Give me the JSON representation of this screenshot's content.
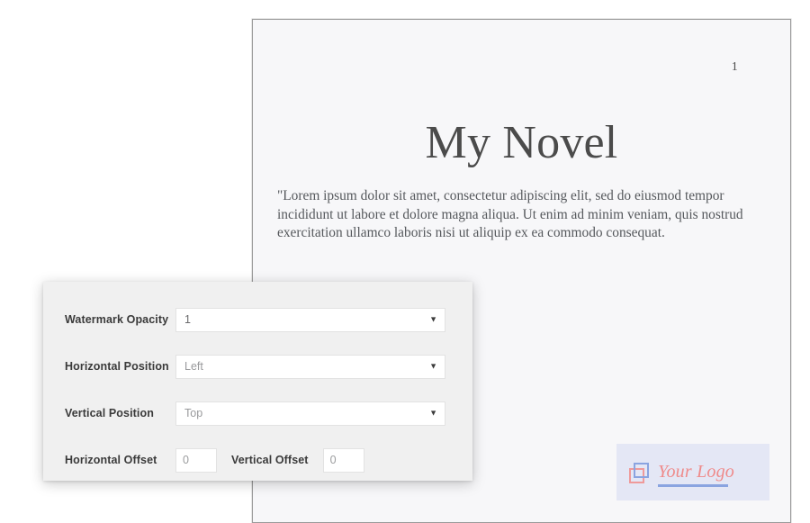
{
  "document": {
    "page_number": "1",
    "title": "My Novel",
    "body": "\"Lorem ipsum dolor sit amet, consectetur adipiscing elit, sed do eiusmod tempor incididunt ut labore et dolore magna aliqua. Ut enim ad minim veniam, quis nostrud exercitation ullamco laboris nisi ut aliquip ex ea commodo consequat."
  },
  "watermark": {
    "text": "Your Logo",
    "background_color": "#e4e7f5",
    "text_color": "#ef8a8a",
    "accent_color": "#8aa4e0",
    "mark_square_blue": "blue-square-icon",
    "mark_square_red": "red-square-icon"
  },
  "settings_panel": {
    "rows": [
      {
        "label": "Watermark Opacity",
        "control": "select",
        "value": "1",
        "arrow": "▼"
      },
      {
        "label": "Horizontal Position",
        "control": "select",
        "value": "Left",
        "arrow": "▼"
      },
      {
        "label": "Vertical Position",
        "control": "select",
        "value": "Top",
        "arrow": "▼"
      }
    ],
    "horizontal_offset": {
      "label": "Horizontal Offset",
      "value": "0"
    },
    "vertical_offset": {
      "label": "Vertical Offset",
      "value": "0"
    }
  }
}
